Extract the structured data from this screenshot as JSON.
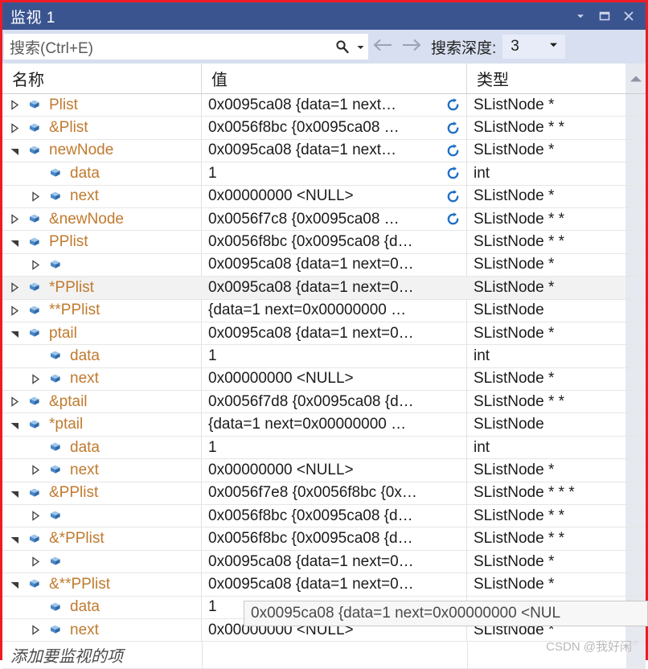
{
  "window": {
    "title": "监视 1",
    "buttons": [
      {
        "name": "dropdown",
        "icon": "chevron-down-icon"
      },
      {
        "name": "restore",
        "icon": "restore-window-icon"
      },
      {
        "name": "close",
        "icon": "close-icon"
      }
    ]
  },
  "toolbar": {
    "search_placeholder": "搜索(Ctrl+E)",
    "search_value": "",
    "search_icon": "search-icon",
    "search_dropdown_icon": "chevron-down-icon",
    "back_icon": "arrow-left-icon",
    "forward_icon": "arrow-right-icon",
    "depth_label": "搜索深度:",
    "depth_value": "3",
    "depth_dropdown_icon": "chevron-down-icon"
  },
  "grid": {
    "columns": [
      "名称",
      "值",
      "类型"
    ],
    "scroll_up_icon": "triangle-up-icon",
    "add_item_placeholder": "添加要监视的项",
    "rows": [
      {
        "indent": 0,
        "twisty": "collapsed",
        "name": "Plist",
        "value": "0x0095ca08 {data=1 next…",
        "type": "SListNode *",
        "refresh": true
      },
      {
        "indent": 0,
        "twisty": "collapsed",
        "name": "&Plist",
        "value": "0x0056f8bc {0x0095ca08 …",
        "type": "SListNode * *",
        "refresh": true
      },
      {
        "indent": 0,
        "twisty": "expanded",
        "name": "newNode",
        "value": "0x0095ca08 {data=1 next…",
        "type": "SListNode *",
        "refresh": true
      },
      {
        "indent": 1,
        "twisty": "none",
        "name": "data",
        "value": "1",
        "type": "int",
        "refresh": true
      },
      {
        "indent": 1,
        "twisty": "collapsed",
        "name": "next",
        "value": "0x00000000 <NULL>",
        "type": "SListNode *",
        "refresh": true
      },
      {
        "indent": 0,
        "twisty": "collapsed",
        "name": "&newNode",
        "value": "0x0056f7c8 {0x0095ca08 …",
        "type": "SListNode * *",
        "refresh": true
      },
      {
        "indent": 0,
        "twisty": "expanded",
        "name": "PPlist",
        "value": "0x0056f8bc {0x0095ca08 {d…",
        "type": "SListNode * *",
        "refresh": false
      },
      {
        "indent": 1,
        "twisty": "collapsed",
        "name": "",
        "value": "0x0095ca08 {data=1 next=0…",
        "type": "SListNode *",
        "refresh": false
      },
      {
        "indent": 0,
        "twisty": "collapsed",
        "name": "*PPlist",
        "value": "0x0095ca08 {data=1 next=0…",
        "type": "SListNode *",
        "refresh": false,
        "selected": true
      },
      {
        "indent": 0,
        "twisty": "collapsed",
        "name": "**PPlist",
        "value": "{data=1 next=0x00000000 …",
        "type": "SListNode",
        "refresh": false
      },
      {
        "indent": 0,
        "twisty": "expanded",
        "name": "ptail",
        "value": "0x0095ca08 {data=1 next=0…",
        "type": "SListNode *",
        "refresh": false
      },
      {
        "indent": 1,
        "twisty": "none",
        "name": "data",
        "value": "1",
        "type": "int",
        "refresh": false
      },
      {
        "indent": 1,
        "twisty": "collapsed",
        "name": "next",
        "value": "0x00000000 <NULL>",
        "type": "SListNode *",
        "refresh": false
      },
      {
        "indent": 0,
        "twisty": "collapsed",
        "name": "&ptail",
        "value": "0x0056f7d8 {0x0095ca08 {d…",
        "type": "SListNode * *",
        "refresh": false
      },
      {
        "indent": 0,
        "twisty": "expanded",
        "name": "*ptail",
        "value": "{data=1 next=0x00000000 …",
        "type": "SListNode",
        "refresh": false
      },
      {
        "indent": 1,
        "twisty": "none",
        "name": "data",
        "value": "1",
        "type": "int",
        "refresh": false
      },
      {
        "indent": 1,
        "twisty": "collapsed",
        "name": "next",
        "value": "0x00000000 <NULL>",
        "type": "SListNode *",
        "refresh": false
      },
      {
        "indent": 0,
        "twisty": "expanded",
        "name": "&PPlist",
        "value": "0x0056f7e8 {0x0056f8bc {0x…",
        "type": "SListNode * * *",
        "refresh": false
      },
      {
        "indent": 1,
        "twisty": "collapsed",
        "name": "",
        "value": "0x0056f8bc {0x0095ca08 {d…",
        "type": "SListNode * *",
        "refresh": false
      },
      {
        "indent": 0,
        "twisty": "expanded",
        "name": "&*PPlist",
        "value": "0x0056f8bc {0x0095ca08 {d…",
        "type": "SListNode * *",
        "refresh": false
      },
      {
        "indent": 1,
        "twisty": "collapsed",
        "name": "",
        "value": "0x0095ca08 {data=1 next=0…",
        "type": "SListNode *",
        "refresh": false
      },
      {
        "indent": 0,
        "twisty": "expanded",
        "name": "&**PPlist",
        "value": "0x0095ca08 {data=1 next=0…",
        "type": "SListNode *",
        "refresh": false
      },
      {
        "indent": 1,
        "twisty": "none",
        "name": "data",
        "value": "1",
        "type": "",
        "refresh": false
      },
      {
        "indent": 1,
        "twisty": "collapsed",
        "name": "next",
        "value": "0x00000000 <NULL>",
        "type": "SListNode *",
        "refresh": false
      }
    ]
  },
  "tooltip": {
    "text": "0x0095ca08 {data=1 next=0x00000000 <NUL"
  },
  "watermark": {
    "text": "CSDN @我好闲",
    "suffix": "☞"
  },
  "colors": {
    "titlebar": "#3a5490",
    "toolbar": "#d8dff0",
    "border": "#ee1c25",
    "name_text": "#c07a2e",
    "refresh_icon": "#1f6fc4",
    "node_icon": "#3f7fd0"
  }
}
